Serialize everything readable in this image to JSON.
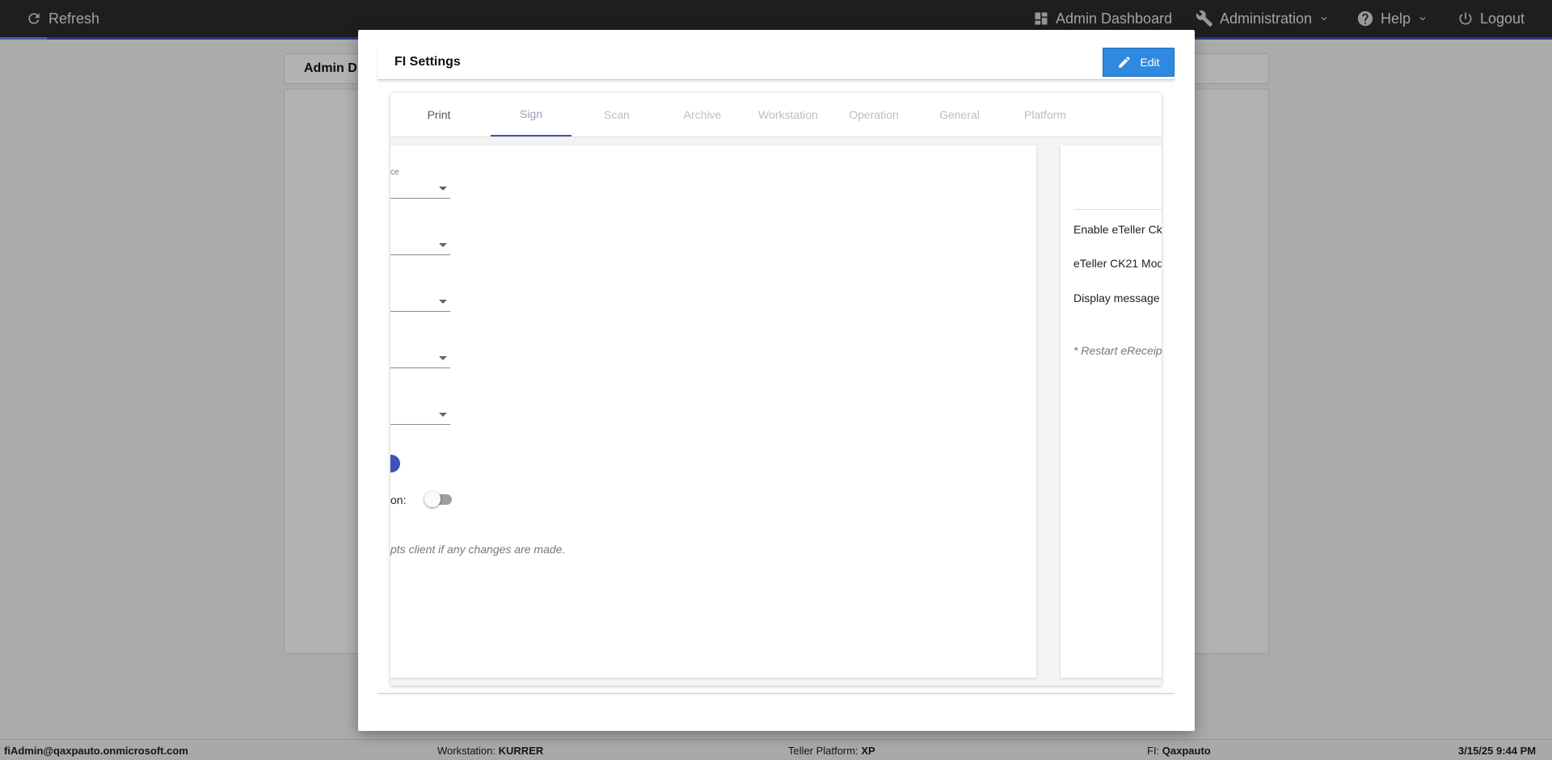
{
  "topbar": {
    "refresh_label": "Refresh",
    "admin_dashboard_label": "Admin Dashboard",
    "administration_label": "Administration",
    "help_label": "Help",
    "logout_label": "Logout",
    "loading_progress": 0.03
  },
  "background": {
    "title_partial": "Admin D"
  },
  "modal": {
    "title": "FI Settings",
    "edit_label": "Edit",
    "tabs": [
      {
        "label": "Print"
      },
      {
        "label": "Sign"
      },
      {
        "label": "Scan"
      },
      {
        "label": "Archive"
      },
      {
        "label": "Workstation"
      },
      {
        "label": "Operation"
      },
      {
        "label": "General"
      },
      {
        "label": "Platform"
      }
    ],
    "active_tab": "Sign",
    "left_card": {
      "first_select_label_fragment": "ce",
      "toggle_label_fragment": "on:",
      "toggle_on": false,
      "note_fragment": "pts client if any changes are made."
    },
    "right_card": {
      "line1": "Enable eTeller Ck",
      "line2": "eTeller CK21 Mod",
      "line3": "Display message",
      "note_fragment": "* Restart eReceip"
    }
  },
  "statusbar": {
    "user": "fiAdmin@qaxpauto.onmicrosoft.com",
    "workstation_label": "Workstation:",
    "workstation_value": "KURRER",
    "platform_label": "Teller Platform:",
    "platform_value": "XP",
    "fi_label": "FI:",
    "fi_value": "Qaxpauto",
    "datetime": "3/15/25 9:44 PM"
  },
  "colors": {
    "accent": "#3f51b5",
    "edit_button": "#2f89df",
    "topbar": "#2b2b2b"
  }
}
